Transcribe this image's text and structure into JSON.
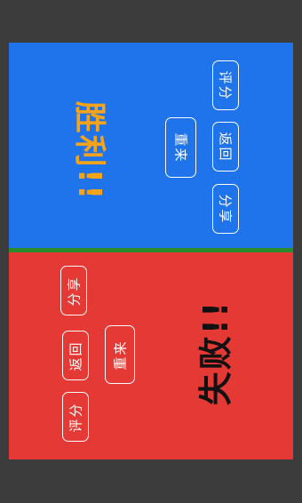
{
  "win_panel": {
    "title": "胜利!!",
    "buttons": {
      "rate": "评分",
      "back": "返回",
      "share": "分享",
      "retry": "重来"
    }
  },
  "lose_panel": {
    "title": "失败!!",
    "buttons": {
      "share": "分享",
      "back": "返回",
      "rate": "评分",
      "retry": "重来"
    }
  },
  "colors": {
    "win_background": "#1f73eb",
    "lose_background": "#e53935",
    "divider": "#2b8a2b",
    "win_title": "#f5a31a",
    "lose_title": "#111111"
  }
}
